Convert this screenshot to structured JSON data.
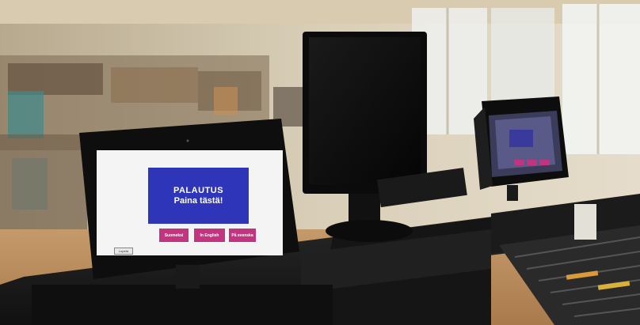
{
  "kiosk": {
    "main_button_line1": "PALAUTUS",
    "main_button_line2": "Paina tästä!",
    "languages": [
      "Suomeksi",
      "In English",
      "På svenska"
    ],
    "corner_button": "Lopeta"
  },
  "colors": {
    "main_button": "#2e35b8",
    "language_buttons": "#c2347f",
    "screen_background": "#f4f4f4"
  }
}
